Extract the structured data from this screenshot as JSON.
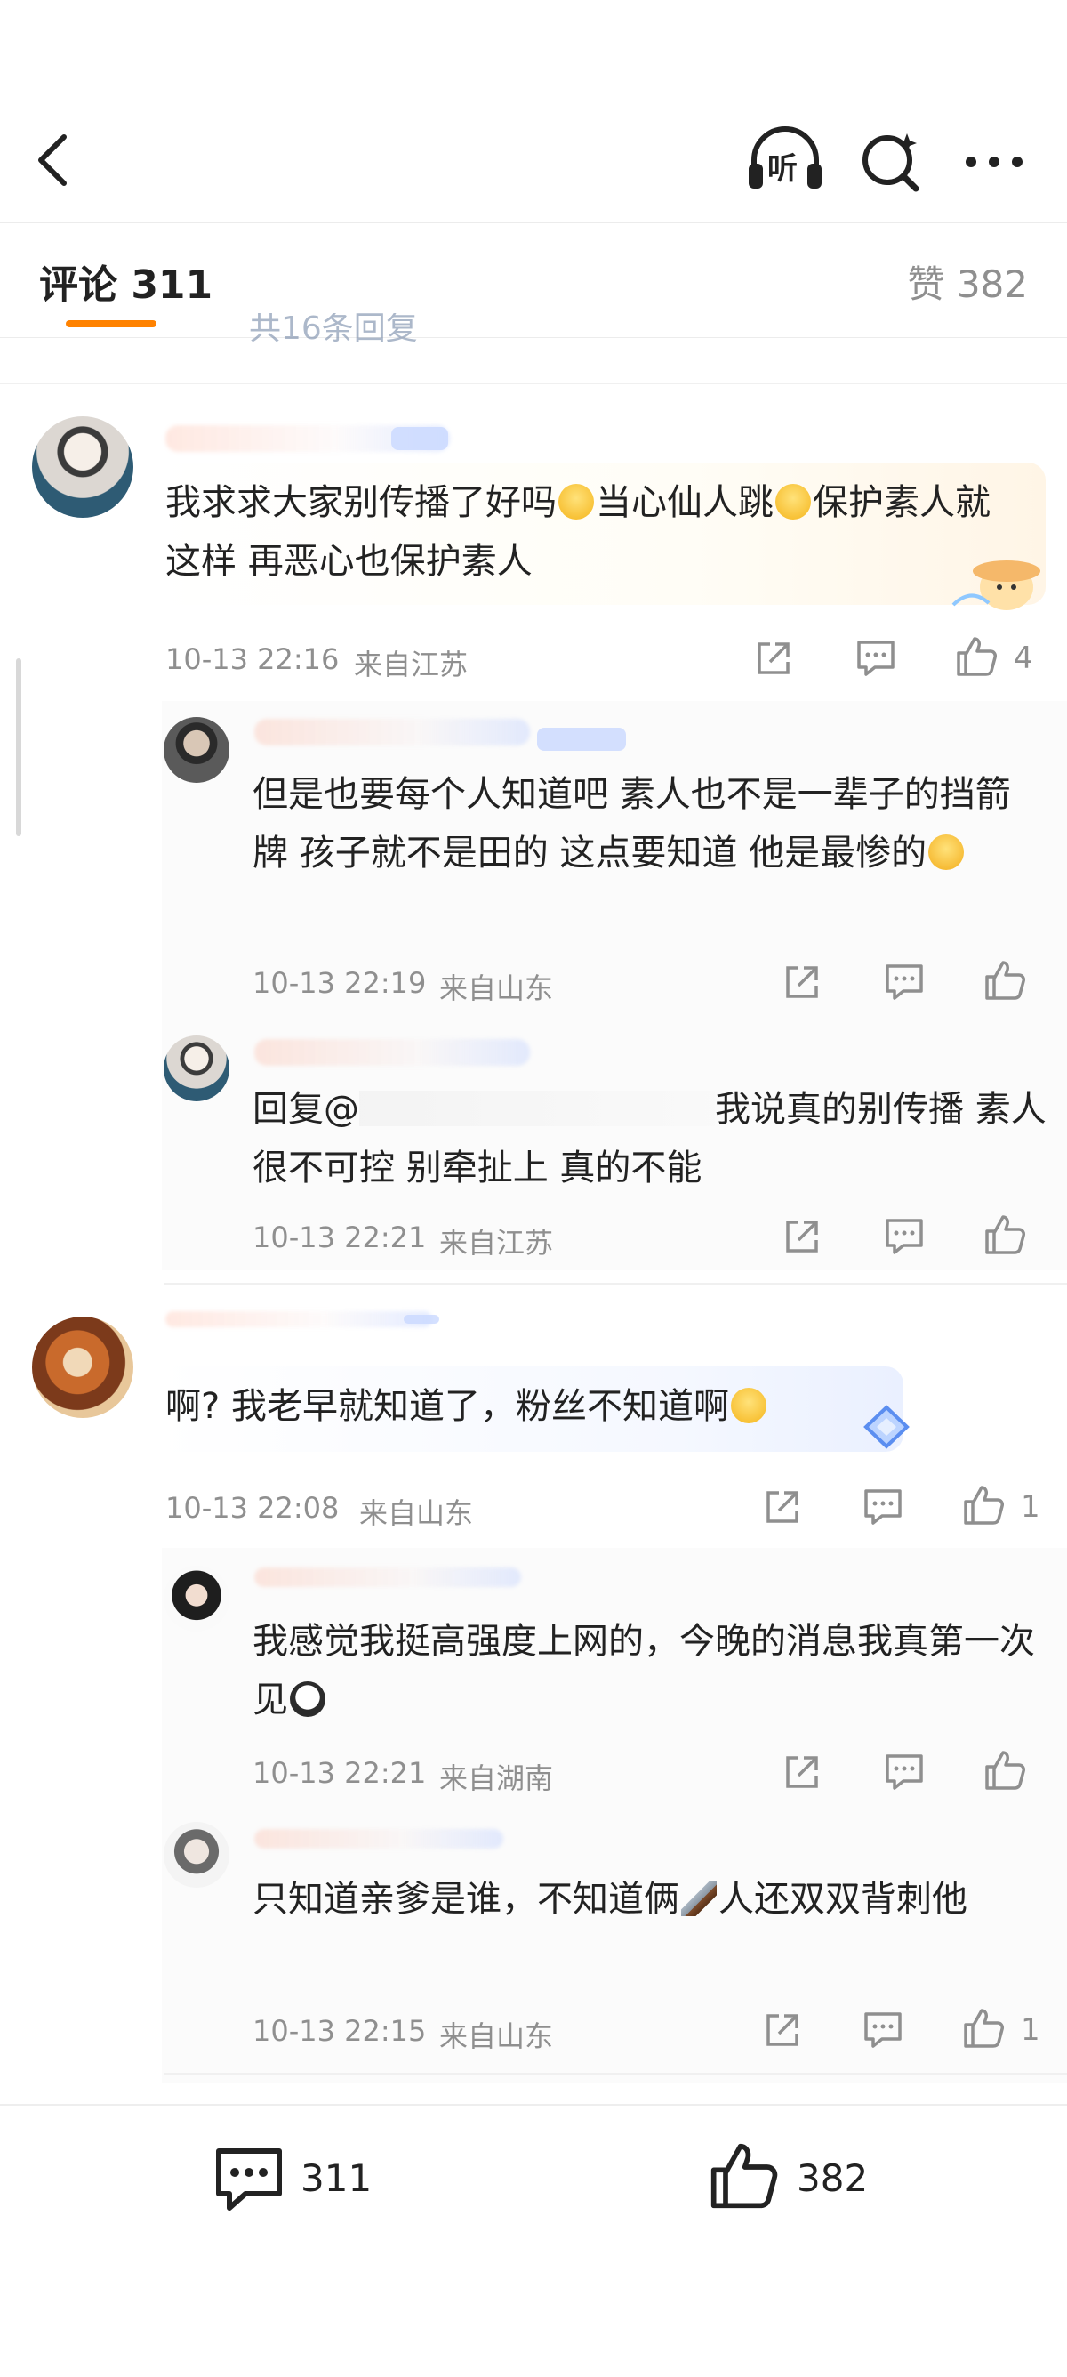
{
  "header": {
    "back_icon": "chevron-left-icon",
    "listen_label": "听",
    "listen_icon": "headphones-icon",
    "search_icon": "search-sparkle-icon",
    "more_icon": "more-dots-icon"
  },
  "tabs": {
    "comments_label": "评论 311",
    "likes_label": "赞 382"
  },
  "cutoff_text": "共16条回复",
  "comments": [
    {
      "text": "我求求大家别传播了好吗🙂当心仙人跳🙂保护素人就这样 再恶心也保护素人",
      "time": "10-13 22:16",
      "location": "来自江苏",
      "likes": "4",
      "replies": [
        {
          "text": "但是也要每个人知道吧 素人也不是一辈子的挡箭牌 孩子就不是田的 这点要知道 他是最惨的",
          "time": "10-13 22:19",
          "location": "来自山东",
          "likes": ""
        },
        {
          "prefix": "回复@",
          "suffix": "我说真的别传播 素人很不可控 别牵扯上 真的不能",
          "time": "10-13 22:21",
          "location": "来自江苏",
          "likes": ""
        }
      ]
    },
    {
      "text": "啊? 我老早就知道了，粉丝不知道啊",
      "time": "10-13 22:08",
      "location": "来自山东",
      "likes": "1",
      "replies": [
        {
          "text": "我感觉我挺高强度上网的，今晚的消息我真第一次见",
          "time": "10-13 22:21",
          "location": "来自湖南",
          "likes": ""
        },
        {
          "text_a": "只知道亲爹是谁，不知道俩",
          "text_b": "人还双双背刺他",
          "time": "10-13 22:15",
          "location": "来自山东",
          "likes": "1"
        }
      ]
    }
  ],
  "bottom": {
    "comment_count": "311",
    "like_count": "382",
    "comment_icon": "comment-bubble-icon",
    "like_icon": "thumbs-up-icon"
  },
  "colors": {
    "accent": "#ff8200",
    "meta": "#8f8f8f",
    "text": "#222222"
  }
}
